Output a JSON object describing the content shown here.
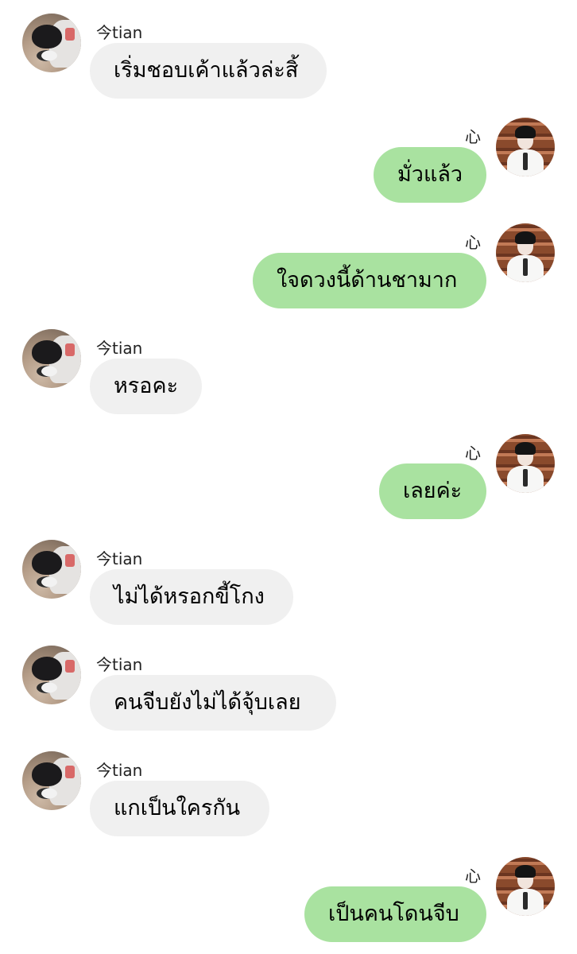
{
  "chat": {
    "messages": [
      {
        "side": "left",
        "sender": "今tian",
        "text": "เริ่มชอบเค้าแล้วล่ะสิ้"
      },
      {
        "side": "right",
        "sender": "心",
        "text": "มั่วแล้ว"
      },
      {
        "side": "right",
        "sender": "心",
        "text": "ใจดวงนี้ด้านชามาก"
      },
      {
        "side": "left",
        "sender": "今tian",
        "text": "หรอคะ"
      },
      {
        "side": "right",
        "sender": "心",
        "text": "เลยค่ะ"
      },
      {
        "side": "left",
        "sender": "今tian",
        "text": "ไม่ได้หรอกขี้โกง"
      },
      {
        "side": "left",
        "sender": "今tian",
        "text": "คนจีบยังไม่ได้จุ้บเลย"
      },
      {
        "side": "left",
        "sender": "今tian",
        "text": "แกเป็นใครกัน"
      },
      {
        "side": "right",
        "sender": "心",
        "text": "เป็นคนโดนจีบ"
      }
    ]
  },
  "colors": {
    "incoming_bubble": "#f0f0f0",
    "outgoing_bubble": "#a9e2a0",
    "background": "#ffffff"
  }
}
